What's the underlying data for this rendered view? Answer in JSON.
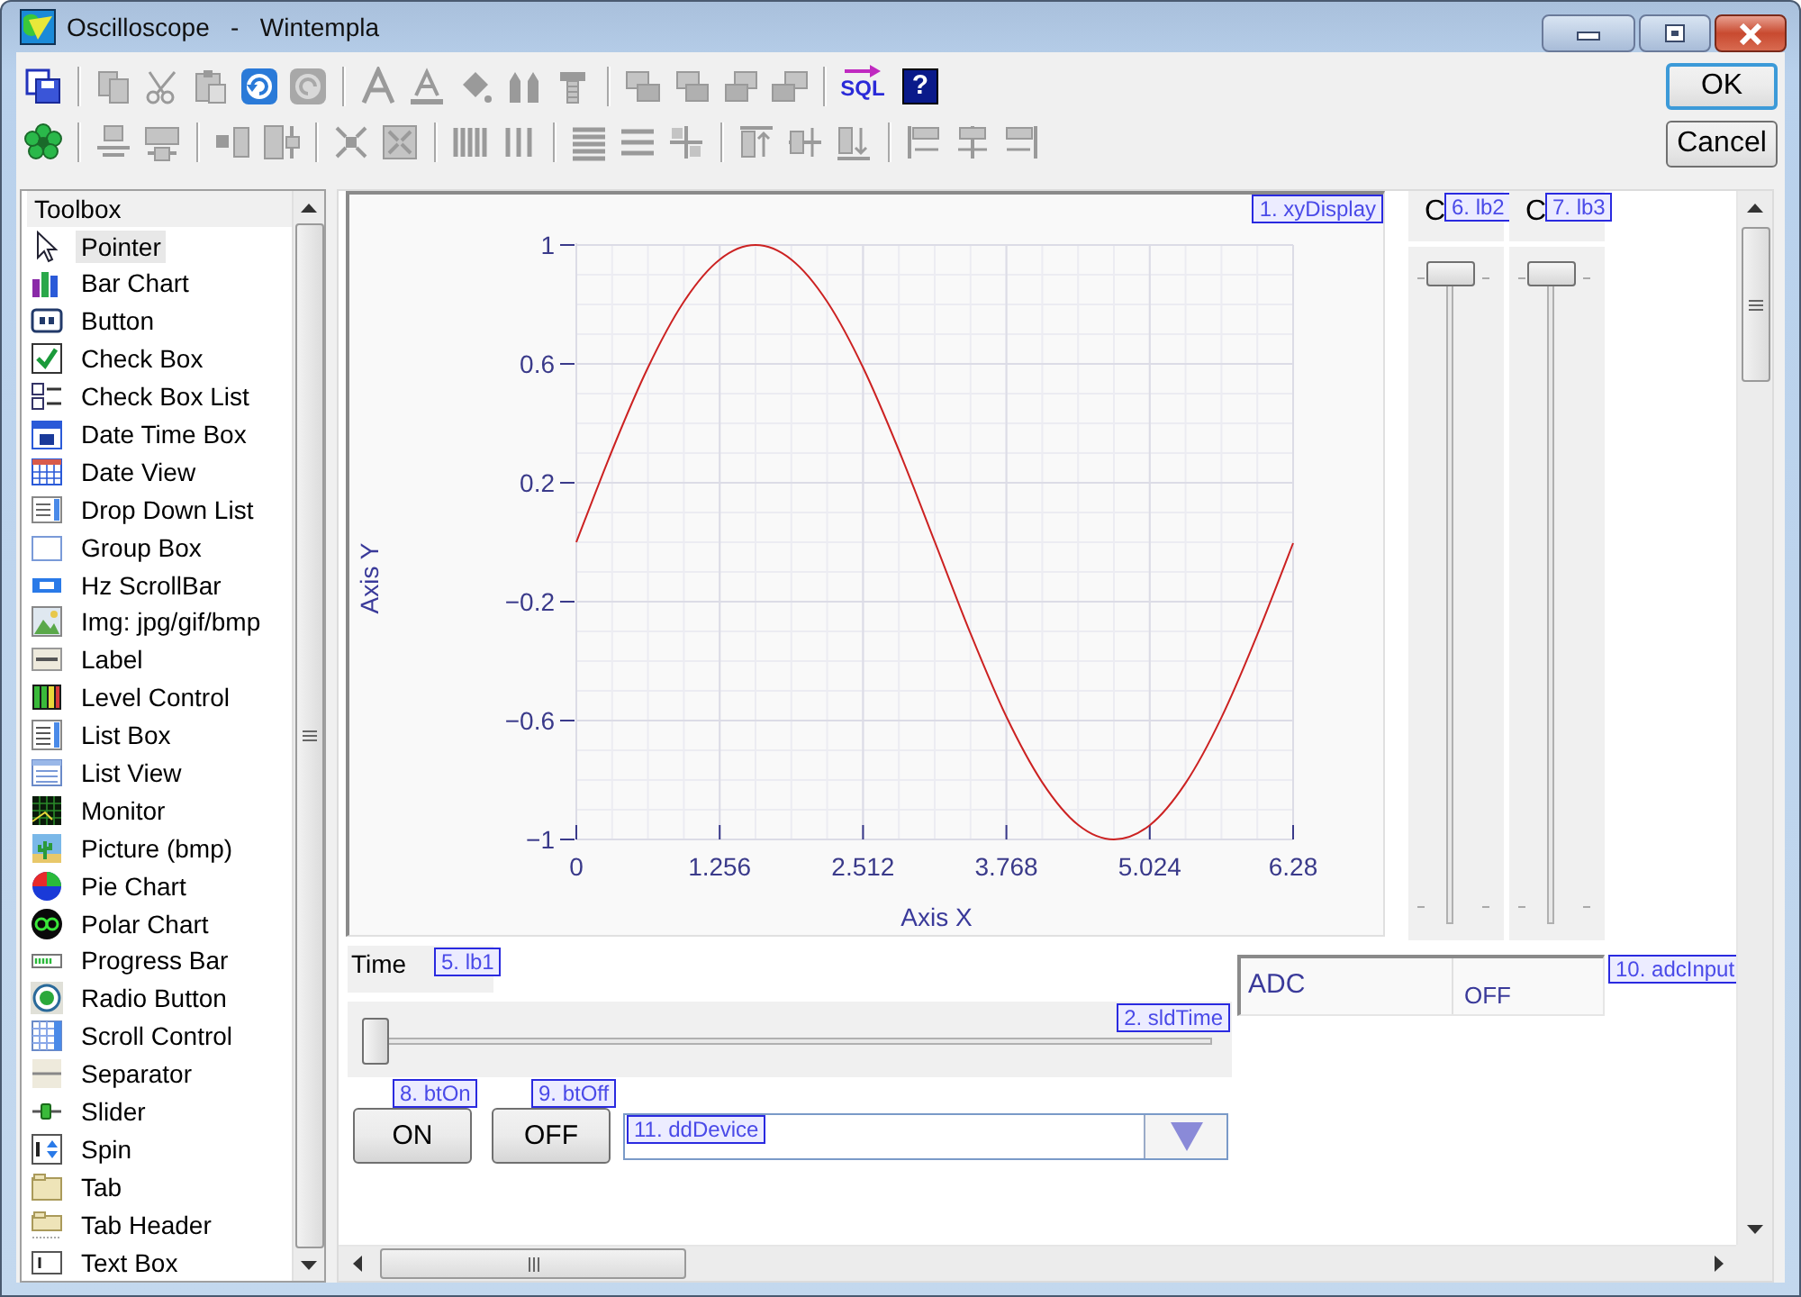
{
  "window": {
    "title": "Oscilloscope   -   Wintempla"
  },
  "toolbar": {
    "sql_label": "SQL",
    "help_label": "?"
  },
  "dialog_buttons": [
    {
      "label": "OK",
      "default": true
    },
    {
      "label": "Cancel",
      "default": false
    }
  ],
  "toolbox": {
    "title": "Toolbox",
    "items": [
      {
        "label": "Pointer",
        "selected": true
      },
      {
        "label": "Bar Chart",
        "selected": false
      },
      {
        "label": "Button",
        "selected": false
      },
      {
        "label": "Check Box",
        "selected": false
      },
      {
        "label": "Check Box List",
        "selected": false
      },
      {
        "label": "Date Time Box",
        "selected": false
      },
      {
        "label": "Date View",
        "selected": false
      },
      {
        "label": "Drop Down List",
        "selected": false
      },
      {
        "label": "Group Box",
        "selected": false
      },
      {
        "label": "Hz ScrollBar",
        "selected": false
      },
      {
        "label": "Img: jpg/gif/bmp",
        "selected": false
      },
      {
        "label": "Label",
        "selected": false
      },
      {
        "label": "Level Control",
        "selected": false
      },
      {
        "label": "List Box",
        "selected": false
      },
      {
        "label": "List View",
        "selected": false
      },
      {
        "label": "Monitor",
        "selected": false
      },
      {
        "label": "Picture (bmp)",
        "selected": false
      },
      {
        "label": "Pie Chart",
        "selected": false
      },
      {
        "label": "Polar Chart",
        "selected": false
      },
      {
        "label": "Progress Bar",
        "selected": false
      },
      {
        "label": "Radio Button",
        "selected": false
      },
      {
        "label": "Scroll Control",
        "selected": false
      },
      {
        "label": "Separator",
        "selected": false
      },
      {
        "label": "Slider",
        "selected": false
      },
      {
        "label": "Spin",
        "selected": false
      },
      {
        "label": "Tab",
        "selected": false
      },
      {
        "label": "Tab Header",
        "selected": false
      },
      {
        "label": "Text Box",
        "selected": false
      }
    ]
  },
  "form": {
    "xy_display": {
      "tag": "1. xyDisplay",
      "chart_data": {
        "type": "line",
        "xlabel": "Axis X",
        "ylabel": "Axis Y",
        "x": [
          0,
          0.314,
          0.628,
          0.942,
          1.256,
          1.57,
          1.884,
          2.198,
          2.512,
          2.826,
          3.14,
          3.454,
          3.768,
          4.082,
          4.396,
          4.71,
          5.024,
          5.338,
          5.652,
          5.966,
          6.28
        ],
        "grid": true,
        "series": [
          {
            "color": "#cc2222",
            "values": [
              0,
              0.309,
              0.588,
              0.809,
              0.951,
              1,
              0.951,
              0.809,
              0.588,
              0.309,
              0.002,
              -0.307,
              -0.587,
              -0.808,
              -0.951,
              -1,
              -0.952,
              -0.81,
              -0.59,
              -0.311,
              -0.003
            ]
          }
        ],
        "xlim": [
          0,
          6.28
        ],
        "ylim": [
          -1,
          1
        ],
        "xticks": [
          {
            "value": 0,
            "label": "0"
          },
          {
            "value": 1.256,
            "label": "1.256"
          },
          {
            "value": 2.512,
            "label": "2.512"
          },
          {
            "value": 3.768,
            "label": "3.768"
          },
          {
            "value": 5.024,
            "label": "5.024"
          },
          {
            "value": 6.28,
            "label": "6.28"
          }
        ],
        "yticks": [
          {
            "value": 1,
            "label": "1"
          },
          {
            "value": 0.6,
            "label": "0.6"
          },
          {
            "value": 0.2,
            "label": "0.2"
          },
          {
            "value": -0.2,
            "label": "−0.2"
          },
          {
            "value": -0.6,
            "label": "−0.6"
          },
          {
            "value": -1,
            "label": "−1"
          }
        ]
      }
    },
    "channel_labels": [
      {
        "text": "C",
        "tag": "6. lb2"
      },
      {
        "text": "C",
        "tag": "7. lb3"
      }
    ],
    "vertical_sliders": [
      {
        "level": 1
      },
      {
        "level": 1
      }
    ],
    "time_label": {
      "text": "Time",
      "tag": "5. lb1"
    },
    "time_slider": {
      "tag": "2. sldTime",
      "level": 0
    },
    "adc_input": {
      "tag": "10. adcInput",
      "label": "ADC",
      "value": "OFF"
    },
    "buttons": [
      {
        "label": "ON",
        "tag": "8. btOn"
      },
      {
        "label": "OFF",
        "tag": "9. btOff"
      }
    ],
    "dropdown": {
      "tag": "11. ddDevice"
    }
  }
}
